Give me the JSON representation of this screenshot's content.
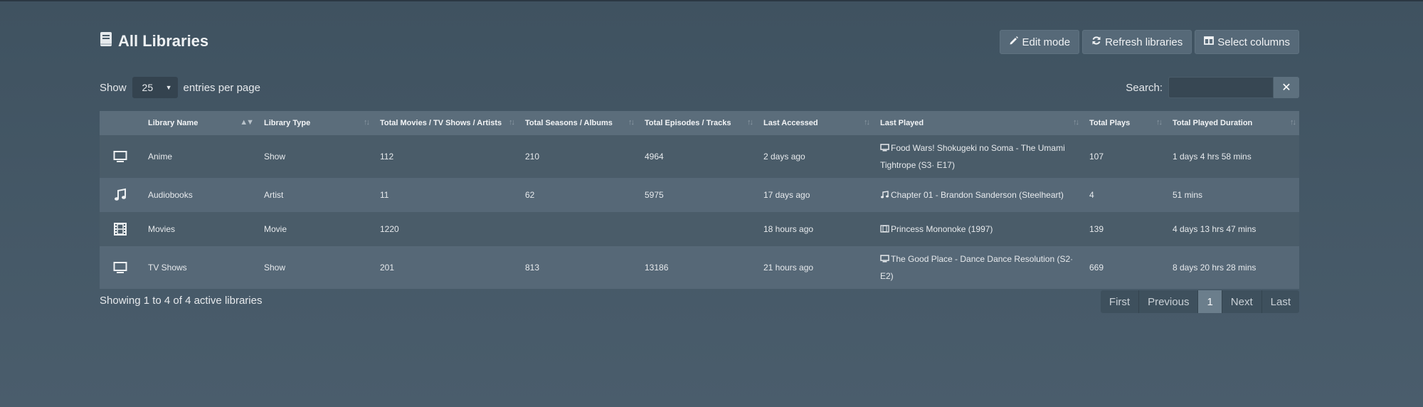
{
  "header": {
    "title": "All Libraries",
    "buttons": {
      "edit_mode": "Edit mode",
      "refresh": "Refresh libraries",
      "select_columns": "Select columns"
    }
  },
  "controls": {
    "show_label": "Show",
    "entries_value": "25",
    "entries_suffix": "entries per page",
    "search_label": "Search:",
    "search_value": "",
    "clear_label": "✕"
  },
  "table": {
    "columns": [
      "",
      "Library Name",
      "Library Type",
      "Total Movies / TV Shows / Artists",
      "Total Seasons / Albums",
      "Total Episodes / Tracks",
      "Last Accessed",
      "Last Played",
      "Total Plays",
      "Total Played Duration"
    ],
    "rows": [
      {
        "icon": "tv-icon",
        "name": "Anime",
        "type": "Show",
        "total_items": "112",
        "seasons": "210",
        "episodes": "4964",
        "last_accessed": "2 days ago",
        "last_played_icon": "tv-icon",
        "last_played": "Food Wars! Shokugeki no Soma - The Umami Tightrope (S3· E17)",
        "plays": "107",
        "duration": "1 days 4 hrs 58 mins"
      },
      {
        "icon": "music-icon",
        "name": "Audiobooks",
        "type": "Artist",
        "total_items": "11",
        "seasons": "62",
        "episodes": "5975",
        "last_accessed": "17 days ago",
        "last_played_icon": "music-icon",
        "last_played": "Chapter 01 - Brandon Sanderson (Steelheart)",
        "plays": "4",
        "duration": "51 mins"
      },
      {
        "icon": "film-icon",
        "name": "Movies",
        "type": "Movie",
        "total_items": "1220",
        "seasons": "",
        "episodes": "",
        "last_accessed": "18 hours ago",
        "last_played_icon": "film-icon",
        "last_played": "Princess Mononoke (1997)",
        "plays": "139",
        "duration": "4 days 13 hrs 47 mins"
      },
      {
        "icon": "tv-icon",
        "name": "TV Shows",
        "type": "Show",
        "total_items": "201",
        "seasons": "813",
        "episodes": "13186",
        "last_accessed": "21 hours ago",
        "last_played_icon": "tv-icon",
        "last_played": "The Good Place - Dance Dance Resolution (S2· E2)",
        "plays": "669",
        "duration": "8 days 20 hrs 28 mins"
      }
    ]
  },
  "footer": {
    "showing": "Showing 1 to 4 of 4 active libraries",
    "pagination": {
      "first": "First",
      "previous": "Previous",
      "current": "1",
      "next": "Next",
      "last": "Last"
    }
  }
}
